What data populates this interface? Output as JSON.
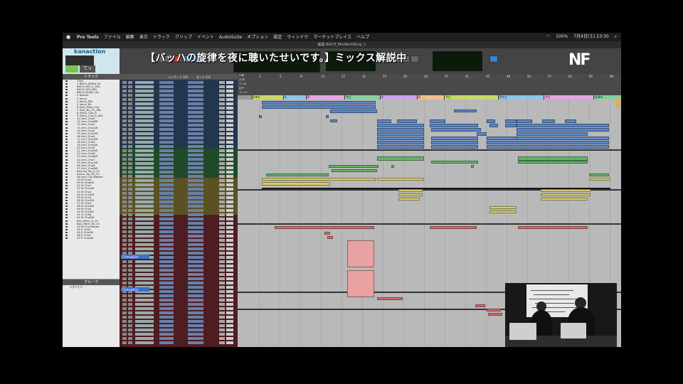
{
  "menubar": {
    "items": [
      "Pro Tools",
      "ファイル",
      "編集",
      "表示",
      "トラック",
      "クリップ",
      "イベント",
      "AudioSuite",
      "オプション",
      "設定",
      "ウィンドウ",
      "マーケットプレイス",
      "ヘルプ"
    ],
    "battery": "100%",
    "clock": "7月4日(土) 23:30"
  },
  "window_title": "編集:BACH_MixWorkShop_1",
  "overlay": {
    "logo_text": "kanaction",
    "logo_sub": "てっ",
    "caption": "【バッハの旋律を夜に聴いたせいです。】ミックス解説中",
    "brand": "NF"
  },
  "tracklist": {
    "header": "トラック",
    "tracks": [
      "Click",
      "1 BACH_NeMe_Nr",
      "BACH_HM_V_16U",
      "BACH_HM_MDr",
      "BACH_NeMe_Vel",
      "2 Master",
      "3 Vocal",
      "4 Vocal_SBL",
      "5 Vocal_Dt",
      "6 Zaki_Sabi_Cho",
      "7 Zaki_Bc_Ch_SBL",
      "8 Zakiy_Cho_A",
      "9 Zakiy_Cho_A_SBL",
      "10 Arm_Cho2",
      "11 Arm_ChoBW",
      "12 Arm_Cho1",
      "13 Arm_Cho1W",
      "14 Arm_Cho2",
      "15 Arm_Cho2W",
      "16 Arm_Cho3",
      "17 Arm_Cho3W",
      "18 Arm_Cho4",
      "19 Arm_Cho4W",
      "20 Arm_Cho5",
      "21 Arm_Cho5W",
      "22 Arm_Cho6",
      "23 Arm_Cho6W",
      "24 Arm_Cho7",
      "25 Arm_Cho7W",
      "26 Arm_Cho8",
      "27 Arm_Cho8W",
      "Bounce_Ke_A_Ch",
      "Bounc_Ky_Sk_Ch",
      "28 Arm Cho Master",
      "29 M Cho0",
      "30 M Cho0W",
      "31 M Cho1",
      "32 M Cho1W",
      "33 M Cho2",
      "34 M Cho2W",
      "35 M Cho3",
      "36 M Cho3W",
      "37 M Cho4",
      "38 M Cho4W",
      "39 M Cho5",
      "40 M Cho5W",
      "41 M Cho6",
      "42 M Cho6W",
      "Bou_Mem_A_Ch",
      "Bou_Mem_Sk_Ch",
      "43 M Cho Master",
      "44 E Cho3",
      "45 E Cho3W",
      "46 E Cho4",
      "47 E Cho4W"
    ]
  },
  "groups": {
    "header": "グループ",
    "items": [
      "<すべて>"
    ]
  },
  "mixer": {
    "insert_label": "インサート A-E",
    "send_label": "センド A-E",
    "plugins": [
      "ChAmpDist",
      "ChAmpDist"
    ]
  },
  "ruler": {
    "bars": [
      "1",
      "5",
      "9",
      "13",
      "17",
      "21",
      "25",
      "29",
      "33",
      "37",
      "41",
      "45",
      "49",
      "53",
      "57",
      "61",
      "65",
      "69"
    ],
    "row_labels": [
      "小節",
      "分:秒",
      "テンポ",
      "拍子",
      "マーカー"
    ]
  },
  "markers": [
    "Intro",
    "A",
    "B",
    "サビ",
    "A",
    "B",
    "サビ",
    "Dサビ",
    "サビ",
    "Outro"
  ],
  "colors": {
    "accent_blue": "#5b86c4",
    "clip_green": "#66b36a",
    "clip_yellow": "#d8cc72",
    "clip_red": "#d26d72",
    "marker_palette": [
      "#c9d86a",
      "#8fc5e8",
      "#e5a5e3",
      "#86d0a0",
      "#c9a3ef",
      "#f0c08a"
    ]
  }
}
